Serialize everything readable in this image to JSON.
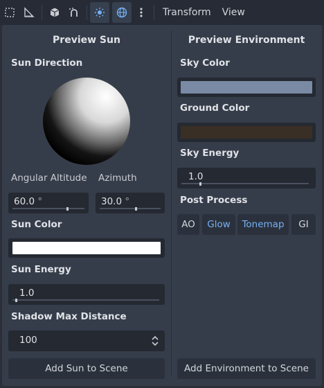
{
  "toolbar": {
    "icons": [
      "grid-select-icon",
      "ruler-icon",
      "cube-icon",
      "snap-magnet-icon",
      "sun-icon",
      "globe-icon",
      "more-vertical-icon"
    ],
    "menus": [
      "Transform",
      "View"
    ]
  },
  "sun": {
    "title": "Preview Sun",
    "direction_label": "Sun Direction",
    "altitude_label": "Angular Altitude",
    "azimuth_label": "Azimuth",
    "altitude_value": "60.0",
    "altitude_unit": "°",
    "altitude_fraction": 0.75,
    "azimuth_value": "30.0",
    "azimuth_unit": "°",
    "azimuth_fraction": 0.58,
    "color_label": "Sun Color",
    "color": "#ffffff",
    "energy_label": "Sun Energy",
    "energy_value": "1.0",
    "energy_fraction": 0.02,
    "shadow_label": "Shadow Max Distance",
    "shadow_value": "100",
    "add_button": "Add Sun to Scene"
  },
  "env": {
    "title": "Preview Environment",
    "sky_color_label": "Sky Color",
    "sky_color": "#7a8aa5",
    "ground_color_label": "Ground Color",
    "ground_color": "#3a2f24",
    "sky_energy_label": "Sky Energy",
    "sky_energy_value": "1.0",
    "sky_energy_fraction": 0.14,
    "post_process_label": "Post Process",
    "post_buttons": [
      {
        "label": "AO",
        "on": false
      },
      {
        "label": "Glow",
        "on": true
      },
      {
        "label": "Tonemap",
        "on": true
      },
      {
        "label": "GI",
        "on": false
      }
    ],
    "add_button": "Add Environment to Scene"
  },
  "colors": {
    "accent": "#76b0f3",
    "panel": "#363d4a",
    "field": "#242932"
  }
}
